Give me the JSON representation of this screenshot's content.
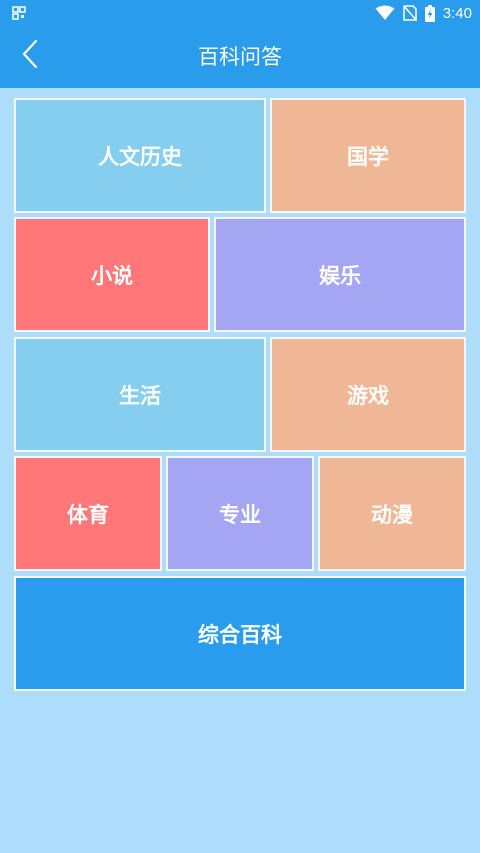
{
  "status_bar": {
    "time": "3:40",
    "icons": [
      "qr-icon",
      "wifi-icon",
      "no-sim-icon",
      "battery-charging-icon"
    ]
  },
  "app_bar": {
    "back_icon": "chevron-left-icon",
    "title": "百科问答"
  },
  "categories": [
    {
      "label": "人文历史",
      "color": "#86ceef"
    },
    {
      "label": "国学",
      "color": "#efb795"
    },
    {
      "label": "小说",
      "color": "#ff7779"
    },
    {
      "label": "娱乐",
      "color": "#a4a6f4"
    },
    {
      "label": "生活",
      "color": "#86ceef"
    },
    {
      "label": "游戏",
      "color": "#efb795"
    },
    {
      "label": "体育",
      "color": "#ff7779"
    },
    {
      "label": "专业",
      "color": "#a4a6f4"
    },
    {
      "label": "动漫",
      "color": "#efb795"
    },
    {
      "label": "综合百科",
      "color": "#299ced"
    }
  ],
  "colors": {
    "header": "#2a9cec",
    "background": "#aedcfb"
  }
}
